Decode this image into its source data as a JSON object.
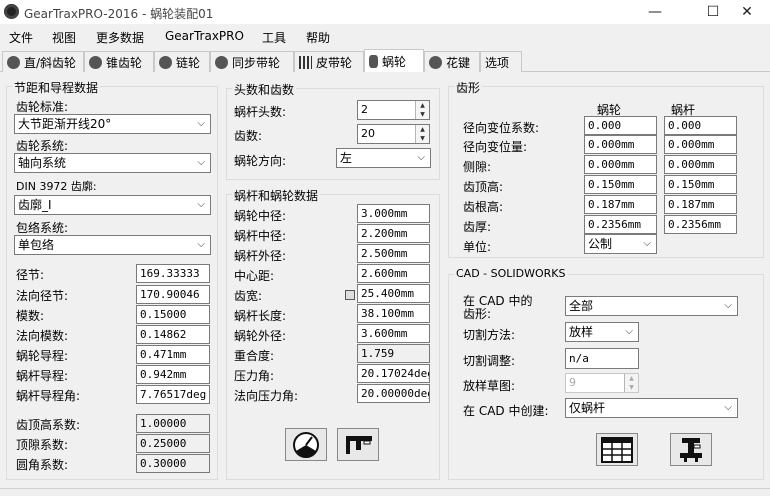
{
  "window": {
    "title": "GearTraxPRO-2016 - 蜗轮装配01",
    "controls": {
      "minimize": "—",
      "maximize": "☐",
      "close": "✕"
    }
  },
  "menu": [
    "文件",
    "视图",
    "更多数据",
    "GearTraxPRO",
    "工具",
    "帮助"
  ],
  "tabs": [
    {
      "label": "直/斜齿轮",
      "icon": "spur-gear-icon"
    },
    {
      "label": "锥齿轮",
      "icon": "bevel-gear-icon"
    },
    {
      "label": "链轮",
      "icon": "sprocket-icon"
    },
    {
      "label": "同步带轮",
      "icon": "timing-pulley-icon"
    },
    {
      "label": "皮带轮",
      "icon": "belt-pulley-icon"
    },
    {
      "label": "蜗轮",
      "icon": "worm-gear-icon",
      "active": true
    },
    {
      "label": "花键",
      "icon": "spline-icon"
    },
    {
      "label": "选项",
      "icon": ""
    }
  ],
  "pitch": {
    "title": "节距和导程数据",
    "standard_label": "齿轮标准:",
    "standard_value": "大节距渐开线20°",
    "system_label": "齿轮系统:",
    "system_value": "轴向系统",
    "din_label": "DIN 3972 齿廓:",
    "din_value": "齿廓_I",
    "envelope_label": "包络系统:",
    "envelope_value": "单包络",
    "rows": [
      {
        "label": "径节:",
        "value": "169.33333"
      },
      {
        "label": "法向径节:",
        "value": "170.90046"
      },
      {
        "label": "模数:",
        "value": "0.15000"
      },
      {
        "label": "法向模数:",
        "value": "0.14862"
      },
      {
        "label": "蜗轮导程:",
        "value": "0.471mm"
      },
      {
        "label": "蜗杆导程:",
        "value": "0.942mm"
      },
      {
        "label": "蜗杆导程角:",
        "value": "7.76517deg"
      }
    ],
    "coef_rows": [
      {
        "label": "齿顶高系数:",
        "value": "1.00000"
      },
      {
        "label": "顶隙系数:",
        "value": "0.25000"
      },
      {
        "label": "圆角系数:",
        "value": "0.30000"
      }
    ]
  },
  "heads": {
    "title": "头数和齿数",
    "starts_label": "蜗杆头数:",
    "starts_value": "2",
    "teeth_label": "齿数:",
    "teeth_value": "20",
    "direction_label": "蜗轮方向:",
    "direction_value": "左"
  },
  "worm_data": {
    "title": "蜗杆和蜗轮数据",
    "rows": [
      {
        "label": "蜗轮中径:",
        "value": "3.000mm"
      },
      {
        "label": "蜗杆中径:",
        "value": "2.200mm"
      },
      {
        "label": "蜗杆外径:",
        "value": "2.500mm"
      },
      {
        "label": "中心距:",
        "value": "2.600mm"
      },
      {
        "label": "齿宽:",
        "value": "25.400mm"
      },
      {
        "label": "蜗杆长度:",
        "value": "38.100mm"
      },
      {
        "label": "蜗轮外径:",
        "value": "3.600mm"
      },
      {
        "label": "重合度:",
        "value": "1.759"
      },
      {
        "label": "压力角:",
        "value": "20.17024deg"
      },
      {
        "label": "法向压力角:",
        "value": "20.00000deg"
      }
    ],
    "buttons": [
      {
        "name": "calculate-button",
        "icon": "gauge-icon"
      },
      {
        "name": "measure-button",
        "icon": "caliper-icon"
      }
    ]
  },
  "tooth_form": {
    "title": "齿形",
    "col_wheel": "蜗轮",
    "col_worm": "蜗杆",
    "rows": [
      {
        "label": "径向变位系数:",
        "wheel": "0.000",
        "worm": "0.000"
      },
      {
        "label": "径向变位量:",
        "wheel": "0.000mm",
        "worm": "0.000mm"
      },
      {
        "label": "侧隙:",
        "wheel": "0.000mm",
        "worm": "0.000mm"
      },
      {
        "label": "齿顶高:",
        "wheel": "0.150mm",
        "worm": "0.150mm"
      },
      {
        "label": "齿根高:",
        "wheel": "0.187mm",
        "worm": "0.187mm"
      },
      {
        "label": "齿厚:",
        "wheel": "0.2356mm",
        "worm": "0.2356mm"
      }
    ],
    "unit_label": "单位:",
    "unit_value": "公制"
  },
  "cad": {
    "title": "CAD - SOLIDWORKS",
    "tooth_form_label_1": "在 CAD 中的",
    "tooth_form_label_2": "齿形:",
    "tooth_form_value": "全部",
    "cut_label": "切割方法:",
    "cut_value": "放样",
    "adjust_label": "切割调整:",
    "adjust_value": "n/a",
    "sketch_label": "放样草图:",
    "sketch_value": "9",
    "create_label": "在 CAD 中创建:",
    "create_value": "仅蜗杆",
    "buttons": [
      {
        "name": "table-button",
        "icon": "table-icon"
      },
      {
        "name": "create-in-cad-button",
        "icon": "cad-create-icon"
      }
    ]
  }
}
